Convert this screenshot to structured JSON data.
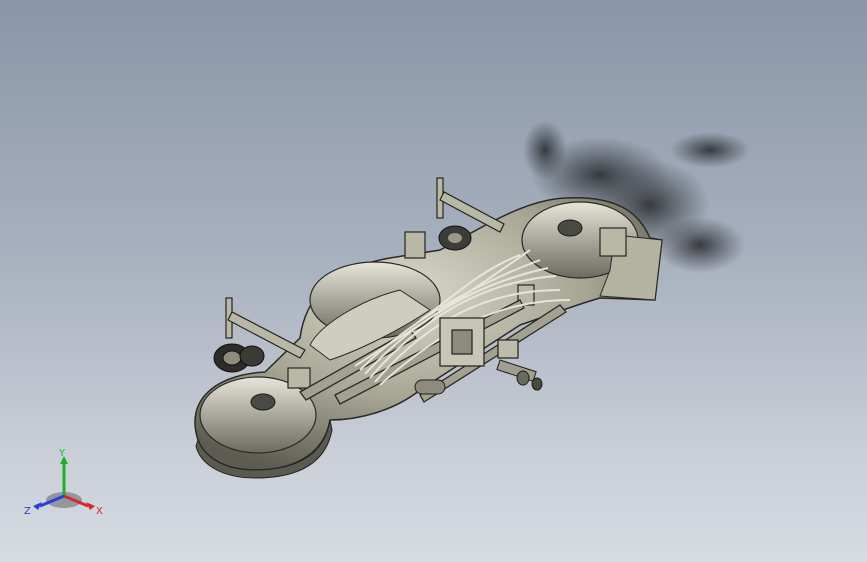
{
  "viewport": {
    "model": "mower-deck-assembly",
    "render_style": "shaded-with-edges"
  },
  "triad": {
    "x_label": "X",
    "y_label": "Y",
    "z_label": "Z",
    "colors": {
      "x": "#d42a2a",
      "y": "#1fae2a",
      "z": "#2a3fd4"
    }
  },
  "colors": {
    "background_top": "#8a96a8",
    "background_bottom": "#d7dbe2",
    "deck_body": "#a7a594",
    "deck_shadow": "#2b2d2f"
  }
}
